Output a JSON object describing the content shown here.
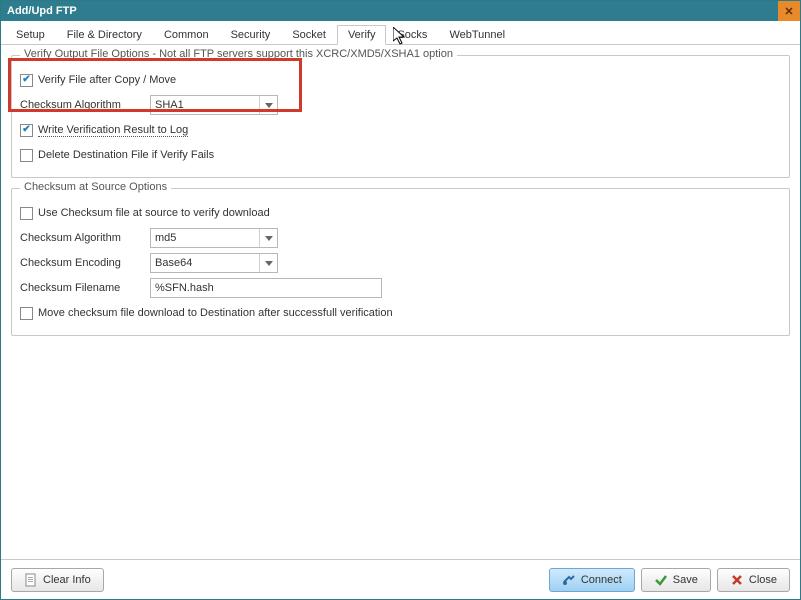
{
  "window": {
    "title": "Add/Upd FTP"
  },
  "tabs": [
    "Setup",
    "File & Directory",
    "Common",
    "Security",
    "Socket",
    "Verify",
    "Socks",
    "WebTunnel"
  ],
  "active_tab": "Verify",
  "group1": {
    "legend": "Verify Output File Options - Not all FTP servers support this  XCRC/XMD5/XSHA1 option",
    "verify_after": {
      "checked": true,
      "label": "Verify File after Copy / Move"
    },
    "algo_label": "Checksum Algorithm",
    "algo_value": "SHA1",
    "write_log": {
      "checked": true,
      "label": "Write Verification Result to Log"
    },
    "delete_fail": {
      "checked": false,
      "label": "Delete Destination File if Verify Fails"
    }
  },
  "group2": {
    "legend": "Checksum at Source Options",
    "use_checksum": {
      "checked": false,
      "label": "Use Checksum file at source to verify download"
    },
    "algo_label": "Checksum Algorithm",
    "algo_value": "md5",
    "encoding_label": "Checksum Encoding",
    "encoding_value": "Base64",
    "filename_label": "Checksum Filename",
    "filename_value": "%SFN.hash",
    "move_checksum": {
      "checked": false,
      "label": "Move checksum file download to Destination after successfull verification"
    }
  },
  "footer": {
    "clear": "Clear Info",
    "connect": "Connect",
    "save": "Save",
    "close": "Close"
  },
  "colors": {
    "accent": "#2d7d8f",
    "highlight": "#d03a2a"
  }
}
